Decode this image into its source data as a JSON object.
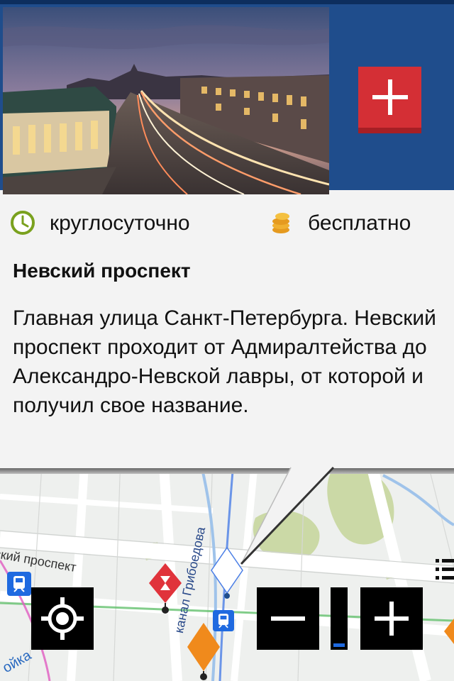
{
  "place": {
    "hours": "круглосуточно",
    "price": "бесплатно",
    "title": "Невский проспект",
    "description": "Главная улица Санкт-Петербурга. Невский проспект проходит от Адмиралтейства до Александро-Невской лавры, от которой и получил свое название."
  },
  "map": {
    "street_label_nevsky": "ский проспект",
    "street_label_canal": "канал Грибоедова",
    "street_label_corner": "ойка",
    "zoom_level": 0.05
  },
  "colors": {
    "header_bg": "#1f4d8c",
    "add_button": "#d42f35",
    "clock_icon": "#7aa11e",
    "coins_icon": "#e59a1f",
    "zoom_fill": "#1f6ae0",
    "pin_red": "#e0333b",
    "pin_orange": "#f08a1c"
  },
  "icons": {
    "add": "plus-icon",
    "clock": "clock-icon",
    "coins": "coins-icon",
    "locate": "crosshair-icon",
    "zoom_out": "minus-icon",
    "zoom_in": "plus-icon",
    "list": "list-icon",
    "metro": "metro-icon"
  }
}
